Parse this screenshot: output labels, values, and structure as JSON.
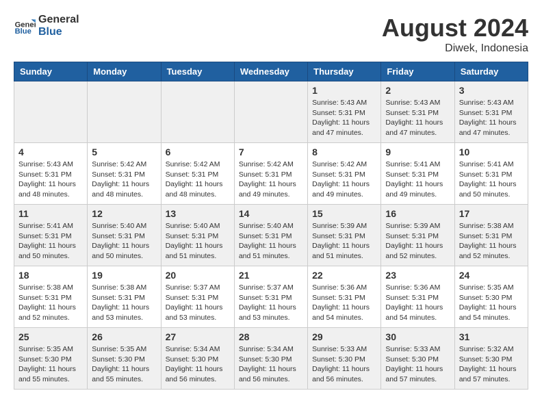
{
  "header": {
    "logo_general": "General",
    "logo_blue": "Blue",
    "month_year": "August 2024",
    "location": "Diwek, Indonesia"
  },
  "days_of_week": [
    "Sunday",
    "Monday",
    "Tuesday",
    "Wednesday",
    "Thursday",
    "Friday",
    "Saturday"
  ],
  "weeks": [
    {
      "days": [
        {
          "number": "",
          "info": ""
        },
        {
          "number": "",
          "info": ""
        },
        {
          "number": "",
          "info": ""
        },
        {
          "number": "",
          "info": ""
        },
        {
          "number": "1",
          "info": "Sunrise: 5:43 AM\nSunset: 5:31 PM\nDaylight: 11 hours and 47 minutes."
        },
        {
          "number": "2",
          "info": "Sunrise: 5:43 AM\nSunset: 5:31 PM\nDaylight: 11 hours and 47 minutes."
        },
        {
          "number": "3",
          "info": "Sunrise: 5:43 AM\nSunset: 5:31 PM\nDaylight: 11 hours and 47 minutes."
        }
      ]
    },
    {
      "days": [
        {
          "number": "4",
          "info": "Sunrise: 5:43 AM\nSunset: 5:31 PM\nDaylight: 11 hours and 48 minutes."
        },
        {
          "number": "5",
          "info": "Sunrise: 5:42 AM\nSunset: 5:31 PM\nDaylight: 11 hours and 48 minutes."
        },
        {
          "number": "6",
          "info": "Sunrise: 5:42 AM\nSunset: 5:31 PM\nDaylight: 11 hours and 48 minutes."
        },
        {
          "number": "7",
          "info": "Sunrise: 5:42 AM\nSunset: 5:31 PM\nDaylight: 11 hours and 49 minutes."
        },
        {
          "number": "8",
          "info": "Sunrise: 5:42 AM\nSunset: 5:31 PM\nDaylight: 11 hours and 49 minutes."
        },
        {
          "number": "9",
          "info": "Sunrise: 5:41 AM\nSunset: 5:31 PM\nDaylight: 11 hours and 49 minutes."
        },
        {
          "number": "10",
          "info": "Sunrise: 5:41 AM\nSunset: 5:31 PM\nDaylight: 11 hours and 50 minutes."
        }
      ]
    },
    {
      "days": [
        {
          "number": "11",
          "info": "Sunrise: 5:41 AM\nSunset: 5:31 PM\nDaylight: 11 hours and 50 minutes."
        },
        {
          "number": "12",
          "info": "Sunrise: 5:40 AM\nSunset: 5:31 PM\nDaylight: 11 hours and 50 minutes."
        },
        {
          "number": "13",
          "info": "Sunrise: 5:40 AM\nSunset: 5:31 PM\nDaylight: 11 hours and 51 minutes."
        },
        {
          "number": "14",
          "info": "Sunrise: 5:40 AM\nSunset: 5:31 PM\nDaylight: 11 hours and 51 minutes."
        },
        {
          "number": "15",
          "info": "Sunrise: 5:39 AM\nSunset: 5:31 PM\nDaylight: 11 hours and 51 minutes."
        },
        {
          "number": "16",
          "info": "Sunrise: 5:39 AM\nSunset: 5:31 PM\nDaylight: 11 hours and 52 minutes."
        },
        {
          "number": "17",
          "info": "Sunrise: 5:38 AM\nSunset: 5:31 PM\nDaylight: 11 hours and 52 minutes."
        }
      ]
    },
    {
      "days": [
        {
          "number": "18",
          "info": "Sunrise: 5:38 AM\nSunset: 5:31 PM\nDaylight: 11 hours and 52 minutes."
        },
        {
          "number": "19",
          "info": "Sunrise: 5:38 AM\nSunset: 5:31 PM\nDaylight: 11 hours and 53 minutes."
        },
        {
          "number": "20",
          "info": "Sunrise: 5:37 AM\nSunset: 5:31 PM\nDaylight: 11 hours and 53 minutes."
        },
        {
          "number": "21",
          "info": "Sunrise: 5:37 AM\nSunset: 5:31 PM\nDaylight: 11 hours and 53 minutes."
        },
        {
          "number": "22",
          "info": "Sunrise: 5:36 AM\nSunset: 5:31 PM\nDaylight: 11 hours and 54 minutes."
        },
        {
          "number": "23",
          "info": "Sunrise: 5:36 AM\nSunset: 5:31 PM\nDaylight: 11 hours and 54 minutes."
        },
        {
          "number": "24",
          "info": "Sunrise: 5:35 AM\nSunset: 5:30 PM\nDaylight: 11 hours and 54 minutes."
        }
      ]
    },
    {
      "days": [
        {
          "number": "25",
          "info": "Sunrise: 5:35 AM\nSunset: 5:30 PM\nDaylight: 11 hours and 55 minutes."
        },
        {
          "number": "26",
          "info": "Sunrise: 5:35 AM\nSunset: 5:30 PM\nDaylight: 11 hours and 55 minutes."
        },
        {
          "number": "27",
          "info": "Sunrise: 5:34 AM\nSunset: 5:30 PM\nDaylight: 11 hours and 56 minutes."
        },
        {
          "number": "28",
          "info": "Sunrise: 5:34 AM\nSunset: 5:30 PM\nDaylight: 11 hours and 56 minutes."
        },
        {
          "number": "29",
          "info": "Sunrise: 5:33 AM\nSunset: 5:30 PM\nDaylight: 11 hours and 56 minutes."
        },
        {
          "number": "30",
          "info": "Sunrise: 5:33 AM\nSunset: 5:30 PM\nDaylight: 11 hours and 57 minutes."
        },
        {
          "number": "31",
          "info": "Sunrise: 5:32 AM\nSunset: 5:30 PM\nDaylight: 11 hours and 57 minutes."
        }
      ]
    }
  ]
}
